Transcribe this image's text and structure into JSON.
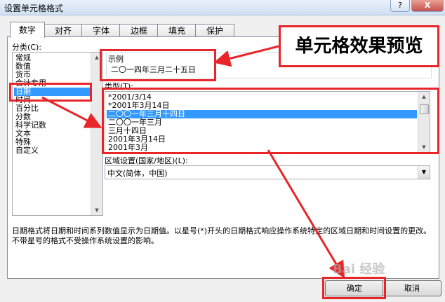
{
  "window": {
    "title": "设置单元格格式",
    "help": "?",
    "close": "X"
  },
  "tabs": [
    {
      "label": "数字"
    },
    {
      "label": "对齐"
    },
    {
      "label": "字体"
    },
    {
      "label": "边框"
    },
    {
      "label": "填充"
    },
    {
      "label": "保护"
    }
  ],
  "category": {
    "label": "分类(C):",
    "items": [
      "常规",
      "数值",
      "货币",
      "会计专用",
      "日期",
      "时间",
      "百分比",
      "分数",
      "科学记数",
      "文本",
      "特殊",
      "自定义"
    ],
    "selected": "日期"
  },
  "sample": {
    "label": "示例",
    "value": "二〇一四年三月二十五日"
  },
  "type": {
    "label": "类型(T):",
    "items": [
      "*2001/3/14",
      "*2001年3月14日",
      "二〇〇一年三月十四日",
      "二〇〇一年三月",
      "三月十四日",
      "2001年3月14日",
      "2001年3月"
    ],
    "selected": "二〇〇一年三月十四日"
  },
  "locale": {
    "label": "区域设置(国家/地区)(L):",
    "value": "中文(简体，中国)"
  },
  "description": "日期格式将日期和时间系列数值显示为日期值。以星号(*)开头的日期格式响应操作系统特定的区域日期和时间设置的更改。不带星号的格式不受操作系统设置的影响。",
  "buttons": {
    "ok": "确定",
    "cancel": "取消"
  },
  "annotation": {
    "label": "单元格效果预览"
  },
  "watermark": "Bai 经验",
  "colors": {
    "annotation_red": "#e8262a",
    "selection_blue": "#3399ff"
  }
}
